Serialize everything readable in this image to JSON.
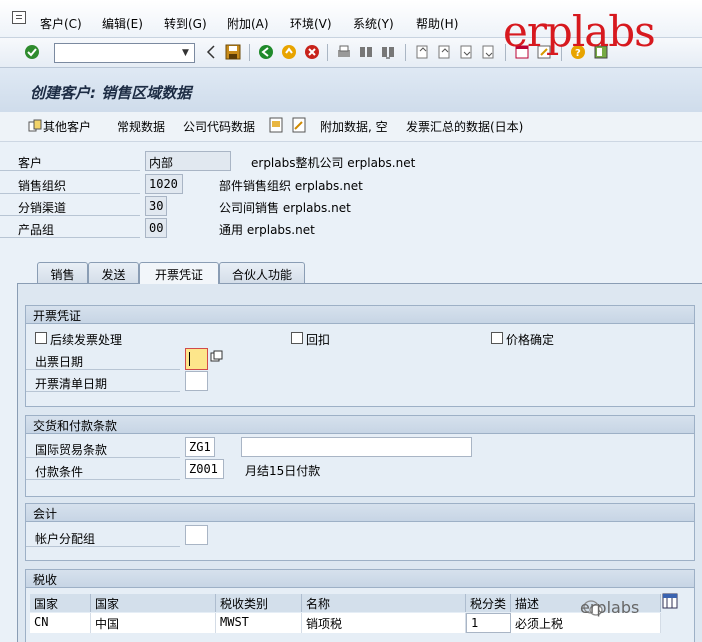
{
  "menu": {
    "items": [
      "客户(C)",
      "编辑(E)",
      "转到(G)",
      "附加(A)",
      "环境(V)",
      "系统(Y)",
      "帮助(H)"
    ]
  },
  "toolbar": {
    "command_value": "",
    "icons": [
      "enter-icon",
      "back-icon",
      "save-icon",
      "back-nav-icon",
      "exit-icon",
      "cancel-icon",
      "print-icon",
      "find-icon",
      "find-next-icon",
      "first-page-icon",
      "prev-page-icon",
      "next-page-icon",
      "last-page-icon",
      "create-session-icon",
      "shortcut-icon",
      "help-icon",
      "layout-icon"
    ]
  },
  "watermark": {
    "top": "erplabs",
    "bottom": "erplabs"
  },
  "title": "创建客户: 销售区域数据",
  "app_toolbar": {
    "other_customer": "其他客户",
    "general_data": "常规数据",
    "company_code_data": "公司代码数据",
    "additional_data": "附加数据, 空",
    "invoice_summary": "发票汇总的数据(日本)"
  },
  "header": {
    "customer": {
      "label": "客户",
      "value": "内部",
      "desc": "erplabs整机公司 erplabs.net"
    },
    "sales_org": {
      "label": "销售组织",
      "value": "1020",
      "desc": "部件销售组织 erplabs.net"
    },
    "channel": {
      "label": "分销渠道",
      "value": "30",
      "desc": "公司间销售 erplabs.net"
    },
    "division": {
      "label": "产品组",
      "value": "00",
      "desc": "通用 erplabs.net"
    }
  },
  "tabs": [
    "销售",
    "发送",
    "开票凭证",
    "合伙人功能"
  ],
  "billing": {
    "title": "开票凭证",
    "subsequent_invoice": "后续发票处理",
    "rebate": "回扣",
    "price_determination": "价格确定",
    "invoice_dates": "出票日期",
    "invoice_list_dates": "开票清单日期"
  },
  "delivery": {
    "title": "交货和付款条款",
    "incoterms_label": "国际贸易条款",
    "incoterms_value": "ZG1",
    "incoterms_text": "",
    "payment_label": "付款条件",
    "payment_value": "Z001",
    "payment_desc": "月结15日付款"
  },
  "accounting": {
    "title": "会计",
    "acct_group_label": "帐户分配组",
    "acct_group_value": ""
  },
  "taxes": {
    "title": "税收",
    "headers": [
      "国家",
      "国家",
      "税收类别",
      "名称",
      "税分类",
      "描述"
    ],
    "row": [
      "CN",
      "中国",
      "MWST",
      "销项税",
      "1",
      "必须上税"
    ]
  }
}
